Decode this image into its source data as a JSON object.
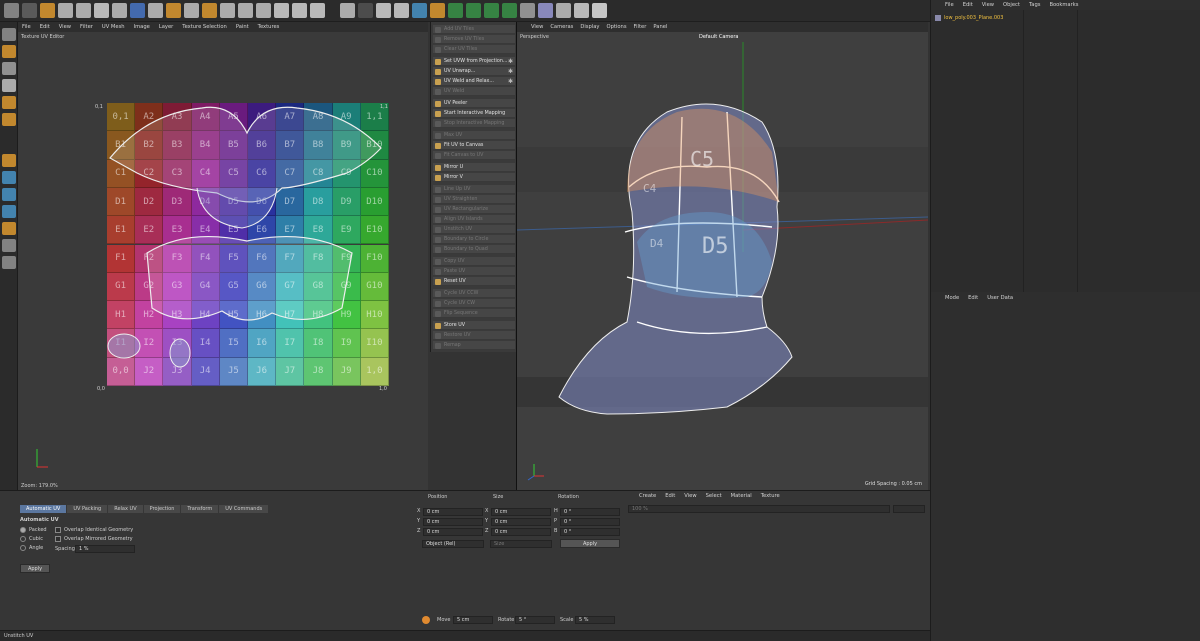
{
  "uv_editor": {
    "menu": [
      "File",
      "Edit",
      "View",
      "Filter",
      "UV Mesh",
      "Image",
      "Layer",
      "Texture Selection",
      "Paint",
      "Textures"
    ],
    "title": "Texture UV Editor",
    "zoom": "Zoom: 179.0%",
    "corners": {
      "tl": "0,1",
      "bl": "0,0",
      "br": "1,0",
      "tr": "1,1"
    },
    "grid_rows": [
      [
        "0,1",
        "A2",
        "A3",
        "A4",
        "A5",
        "A6",
        "A7",
        "A8",
        "A9",
        "1,1"
      ],
      [
        "B1",
        "B2",
        "B3",
        "B4",
        "B5",
        "B6",
        "B7",
        "B8",
        "B9",
        "B10"
      ],
      [
        "C1",
        "C2",
        "C3",
        "C4",
        "C5",
        "C6",
        "C7",
        "C8",
        "C9",
        "C10"
      ],
      [
        "D1",
        "D2",
        "D3",
        "D4",
        "D5",
        "D6",
        "D7",
        "D8",
        "D9",
        "D10"
      ],
      [
        "E1",
        "E2",
        "E3",
        "E4",
        "E5",
        "E6",
        "E7",
        "E8",
        "E9",
        "E10"
      ],
      [
        "F1",
        "F2",
        "F3",
        "F4",
        "F5",
        "F6",
        "F7",
        "F8",
        "F9",
        "F10"
      ],
      [
        "G1",
        "G2",
        "G3",
        "G4",
        "G5",
        "G6",
        "G7",
        "G8",
        "G9",
        "G10"
      ],
      [
        "H1",
        "H2",
        "H3",
        "H4",
        "H5",
        "H6",
        "H7",
        "H8",
        "H9",
        "H10"
      ],
      [
        "I1",
        "I2",
        "I3",
        "I4",
        "I5",
        "I6",
        "I7",
        "I8",
        "I9",
        "I10"
      ],
      [
        "0,0",
        "J2",
        "J3",
        "J4",
        "J5",
        "J6",
        "J7",
        "J8",
        "J9",
        "1,0"
      ]
    ]
  },
  "uv_commands": [
    {
      "label": "Add UV Tiles",
      "enabled": false
    },
    {
      "label": "Remove UV Tiles",
      "enabled": false
    },
    {
      "label": "Clear UV Tiles",
      "enabled": false
    },
    {
      "label": "Set UVW from Projection...",
      "enabled": true,
      "gear": true
    },
    {
      "label": "UV Unwrap...",
      "enabled": true,
      "gear": true
    },
    {
      "label": "UV Weld and Relax...",
      "enabled": true,
      "gear": true
    },
    {
      "label": "UV Weld",
      "enabled": false
    },
    {
      "label": "UV Peeler",
      "enabled": true
    },
    {
      "label": "Start Interactive Mapping",
      "enabled": true
    },
    {
      "label": "Stop Interactive Mapping",
      "enabled": false
    },
    {
      "label": "Max UV",
      "enabled": false
    },
    {
      "label": "Fit UV to Canvas",
      "enabled": true
    },
    {
      "label": "Fit Canvas to UV",
      "enabled": false
    },
    {
      "label": "Mirror U",
      "enabled": true
    },
    {
      "label": "Mirror V",
      "enabled": true
    },
    {
      "label": "Line Up UV",
      "enabled": false
    },
    {
      "label": "UV Straighten",
      "enabled": false
    },
    {
      "label": "UV Rectangularize",
      "enabled": false
    },
    {
      "label": "Align UV Islands",
      "enabled": false
    },
    {
      "label": "Unstitch UV",
      "enabled": false
    },
    {
      "label": "Boundary to Circle",
      "enabled": false
    },
    {
      "label": "Boundary to Quad",
      "enabled": false
    },
    {
      "label": "Copy UV",
      "enabled": false
    },
    {
      "label": "Paste UV",
      "enabled": false
    },
    {
      "label": "Reset UV",
      "enabled": true
    },
    {
      "label": "Cycle UV CCW",
      "enabled": false
    },
    {
      "label": "Cycle UV CW",
      "enabled": false
    },
    {
      "label": "Flip Sequence",
      "enabled": false
    },
    {
      "label": "Store UV",
      "enabled": true
    },
    {
      "label": "Restore UV",
      "enabled": false
    },
    {
      "label": "Remap",
      "enabled": false
    }
  ],
  "viewport": {
    "menu": [
      "View",
      "Cameras",
      "Display",
      "Options",
      "Filter",
      "Panel"
    ],
    "name": "Perspective",
    "camera": "Default Camera",
    "grid_spacing": "Grid Spacing : 0.05 cm",
    "labels": [
      "C5",
      "D5",
      "C4",
      "D4"
    ]
  },
  "object_manager": {
    "menu": [
      "File",
      "Edit",
      "View",
      "Object",
      "Tags",
      "Bookmarks"
    ],
    "object_name": "low_poly.003_Plane.003"
  },
  "attribute_manager": {
    "menu": [
      "Mode",
      "Edit",
      "User Data"
    ]
  },
  "uv_panel": {
    "tabs": [
      "Automatic UV",
      "UV Packing",
      "Relax UV",
      "Projection",
      "Transform",
      "UV Commands"
    ],
    "section": "Automatic UV",
    "options": [
      "Packed",
      "Cubic",
      "Angle"
    ],
    "checks": [
      "Overlap Identical Geometry",
      "Overlap Mirrored Geometry"
    ],
    "spacing_label": "Spacing",
    "spacing_value": "1 %",
    "apply": "Apply"
  },
  "coord_panel": {
    "headers": [
      "Position",
      "Size",
      "Rotation"
    ],
    "rows": [
      {
        "axis": "X",
        "pos": "0 cm",
        "sa": "X",
        "size": "0 cm",
        "ra": "H",
        "rot": "0 °"
      },
      {
        "axis": "Y",
        "pos": "0 cm",
        "sa": "Y",
        "size": "0 cm",
        "ra": "P",
        "rot": "0 °"
      },
      {
        "axis": "Z",
        "pos": "0 cm",
        "sa": "Z",
        "size": "0 cm",
        "ra": "B",
        "rot": "0 °"
      }
    ],
    "mode": "Object (Rel)",
    "size_mode": "Size",
    "apply": "Apply",
    "move_label": "Move",
    "move_val": "5 cm",
    "rotate_label": "Rotate",
    "rotate_val": "5 °",
    "scale_label": "Scale",
    "scale_val": "5 %"
  },
  "material_panel": {
    "menu": [
      "Create",
      "Edit",
      "View",
      "Select",
      "Material",
      "Texture"
    ],
    "zoom": "100 %"
  },
  "status": "Unstitch UV"
}
